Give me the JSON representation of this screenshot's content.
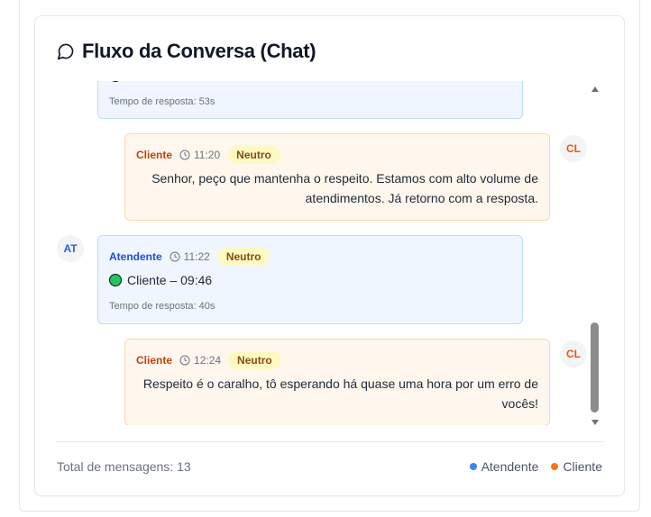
{
  "header": {
    "title": "Fluxo da Conversa (Chat)"
  },
  "messages": [
    {
      "sender": "Atendente",
      "time": "",
      "sentiment": "",
      "text": "",
      "response_time": "Tempo de resposta: 53s"
    },
    {
      "sender": "Cliente",
      "time": "11:20",
      "sentiment": "Neutro",
      "text": "Senhor, peço que mantenha o respeito. Estamos com alto volume de atendimentos. Já retorno com a resposta.",
      "avatar": "CL"
    },
    {
      "sender": "Atendente",
      "time": "11:22",
      "sentiment": "Neutro",
      "text": "Cliente – 09:46",
      "response_time": "Tempo de resposta: 40s",
      "avatar": "AT"
    },
    {
      "sender": "Cliente",
      "time": "12:24",
      "sentiment": "Neutro",
      "text": "Respeito é o caralho, tô esperando há quase uma hora por um erro de vocês!",
      "avatar": "CL"
    }
  ],
  "footer": {
    "total": "Total de mensagens: 13",
    "legend_atendente": "Atendente",
    "legend_cliente": "Cliente"
  },
  "colors": {
    "atendente": "#3b82f6",
    "cliente": "#f97316"
  }
}
